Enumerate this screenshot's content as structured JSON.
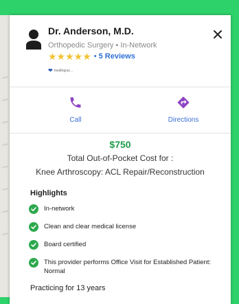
{
  "provider": {
    "name": "Dr. Anderson, M.D.",
    "subtitle": "Orthopedic Surgery • In-Network",
    "stars": "★★★★★",
    "rating": 5,
    "separator": "•",
    "reviews_label": "5 Reviews",
    "source_logo_text": "healthgrac..."
  },
  "actions": {
    "call_label": "Call",
    "directions_label": "Directions"
  },
  "cost": {
    "price": "$750",
    "label": "Total Out-of-Pocket Cost for :",
    "procedure": "Knee Arthroscopy: ACL Repair/Reconstruction"
  },
  "highlights": {
    "title": "Highlights",
    "items": [
      "In-network",
      "Clean and clear medical license",
      "Board certified",
      "This provider performs Office Visit for Established Patient: Normal"
    ]
  },
  "experience": "Practicing for 13 years",
  "colors": {
    "frame_green": "#2ed26a",
    "accent_blue": "#3b6fd4",
    "action_purple": "#8e44c4",
    "price_green": "#1f9d4b",
    "check_green": "#2ea84e",
    "star_yellow": "#f1c232"
  },
  "icons": {
    "avatar": "person-icon",
    "close": "close-icon",
    "call": "phone-icon",
    "directions": "directions-icon",
    "check": "check-circle-icon"
  }
}
